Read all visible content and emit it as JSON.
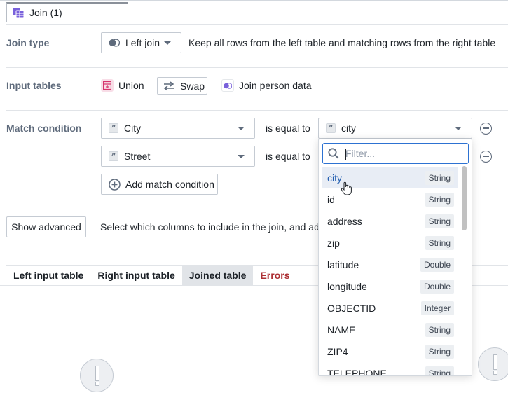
{
  "node": {
    "title": "Join (1)"
  },
  "join_type": {
    "label": "Join type",
    "selected": "Left join",
    "description": "Keep all rows from the left table and matching rows from the right table"
  },
  "input_tables": {
    "label": "Input tables",
    "left": "Union",
    "swap_label": "Swap",
    "right": "Join person data"
  },
  "match_condition": {
    "label": "Match condition",
    "rows": [
      {
        "left": "City",
        "operator": "is equal to",
        "right": "city"
      },
      {
        "left": "Street",
        "operator": "is equal to",
        "right": ""
      }
    ],
    "add_label": "Add match condition"
  },
  "advanced": {
    "button_label": "Show advanced",
    "description": "Select which columns to include in the join, and add a"
  },
  "tabs": [
    {
      "label": "Left input table"
    },
    {
      "label": "Right input table"
    },
    {
      "label": "Joined table",
      "active": true
    },
    {
      "label": "Errors"
    }
  ],
  "dropdown": {
    "filter_placeholder": "Filter...",
    "options": [
      {
        "name": "city",
        "type": "String"
      },
      {
        "name": "id",
        "type": "String"
      },
      {
        "name": "address",
        "type": "String"
      },
      {
        "name": "zip",
        "type": "String"
      },
      {
        "name": "latitude",
        "type": "Double"
      },
      {
        "name": "longitude",
        "type": "Double"
      },
      {
        "name": "OBJECTID",
        "type": "Integer"
      },
      {
        "name": "NAME",
        "type": "String"
      },
      {
        "name": "ZIP4",
        "type": "String"
      },
      {
        "name": "TELEPHONE",
        "type": "String"
      }
    ]
  },
  "colors": {
    "accent": "#2d72d2",
    "error": "#ac2f33",
    "union_icon": "#d6336c",
    "join_icon": "#7961db"
  }
}
